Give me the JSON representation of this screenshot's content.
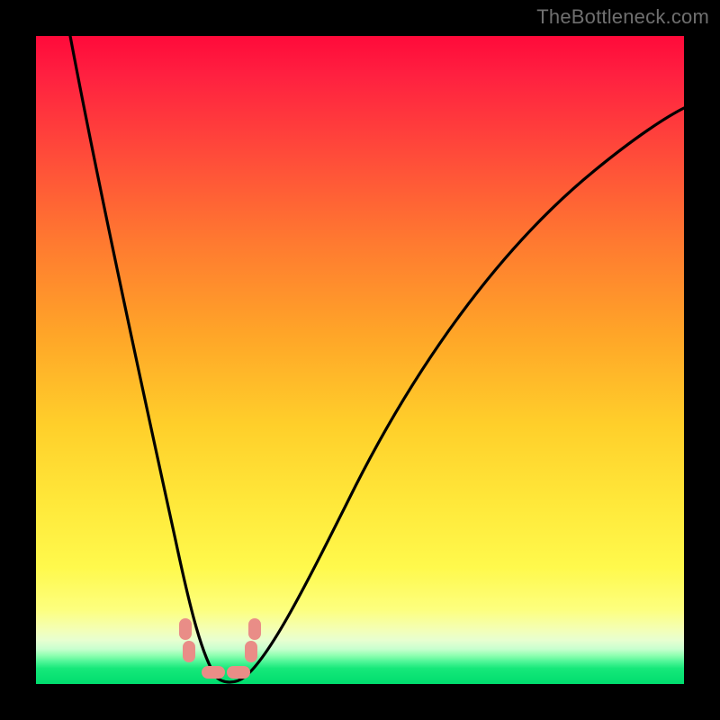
{
  "watermark": {
    "text": "TheBottleneck.com"
  },
  "colors": {
    "frame": "#000000",
    "curve": "#000000",
    "marker": "#e98d87",
    "gradient_stops": [
      "#ff0a3a",
      "#ff4a3a",
      "#ff7a30",
      "#ffa528",
      "#ffcf2a",
      "#ffe83a",
      "#fff94c",
      "#fdff7e",
      "#e8ffd0",
      "#4cf596",
      "#00dd6e"
    ]
  },
  "chart_data": {
    "type": "line",
    "title": "",
    "xlabel": "",
    "ylabel": "",
    "xlim": [
      0,
      100
    ],
    "ylim": [
      0,
      100
    ],
    "grid": false,
    "legend": false,
    "series": [
      {
        "name": "bottleneck-curve",
        "x": [
          5,
          8,
          11,
          14,
          17,
          20,
          23,
          25,
          27,
          29,
          33,
          37,
          41,
          46,
          52,
          60,
          70,
          82,
          94,
          100
        ],
        "values": [
          100,
          80,
          62,
          47,
          34,
          23,
          14,
          8,
          3,
          1,
          3,
          9,
          17,
          27,
          38,
          50,
          62,
          73,
          82,
          86
        ]
      }
    ],
    "markers": [
      {
        "name": "left-tip-top",
        "x": 23.0,
        "y": 8.5
      },
      {
        "name": "left-tip-bottom",
        "x": 23.5,
        "y": 5.0
      },
      {
        "name": "valley-left",
        "x": 26.5,
        "y": 1.5
      },
      {
        "name": "valley-right",
        "x": 30.5,
        "y": 1.5
      },
      {
        "name": "right-tip-bottom",
        "x": 33.0,
        "y": 5.0
      },
      {
        "name": "right-tip-top",
        "x": 33.5,
        "y": 8.5
      }
    ]
  }
}
